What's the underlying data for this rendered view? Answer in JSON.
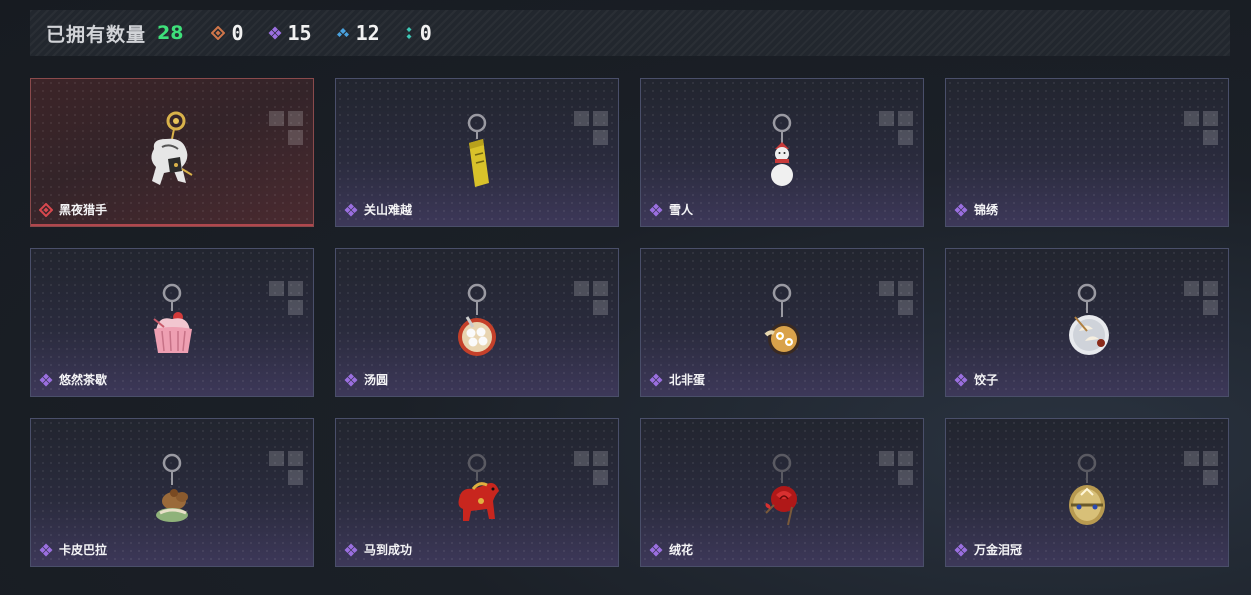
{
  "header": {
    "owned_label": "已拥有数量",
    "owned_count": "28",
    "stats": [
      {
        "icon": "orange-diamond-rarity-icon",
        "color": "#d0764a",
        "value": "0"
      },
      {
        "icon": "purple-diamond-rarity-icon",
        "color": "#9b6fe0",
        "value": "15"
      },
      {
        "icon": "blue-diamond-rarity-icon",
        "color": "#4aa3e0",
        "value": "12"
      },
      {
        "icon": "teal-dots-rarity-icon",
        "color": "#3ec9b7",
        "value": "0"
      }
    ]
  },
  "items": [
    {
      "name": "黑夜猎手",
      "rarity": "red",
      "selected": true,
      "art": "hunter-charm-icon"
    },
    {
      "name": "关山难越",
      "rarity": "purple",
      "selected": false,
      "art": "yellow-can-charm-icon"
    },
    {
      "name": "雪人",
      "rarity": "purple",
      "selected": false,
      "art": "snowman-charm-icon"
    },
    {
      "name": "锦绣",
      "rarity": "purple",
      "selected": false,
      "art": ""
    },
    {
      "name": "悠然茶歇",
      "rarity": "purple",
      "selected": false,
      "art": "cupcake-charm-icon"
    },
    {
      "name": "汤圆",
      "rarity": "purple",
      "selected": false,
      "art": "tangyuan-bowl-charm-icon"
    },
    {
      "name": "北非蛋",
      "rarity": "purple",
      "selected": false,
      "art": "shakshuka-charm-icon"
    },
    {
      "name": "饺子",
      "rarity": "purple",
      "selected": false,
      "art": "dumpling-plate-charm-icon"
    },
    {
      "name": "卡皮巴拉",
      "rarity": "purple",
      "selected": false,
      "art": "capybara-charm-icon"
    },
    {
      "name": "马到成功",
      "rarity": "purple",
      "selected": false,
      "art": "red-horse-charm-icon"
    },
    {
      "name": "绒花",
      "rarity": "purple",
      "selected": false,
      "art": "red-rose-charm-icon"
    },
    {
      "name": "万金泪冠",
      "rarity": "purple",
      "selected": false,
      "art": "golden-crown-egg-charm-icon"
    }
  ],
  "colors": {
    "accent_green": "#3ee07a",
    "rarity_red": "#d8484e",
    "rarity_purple": "#9b6fe0"
  }
}
